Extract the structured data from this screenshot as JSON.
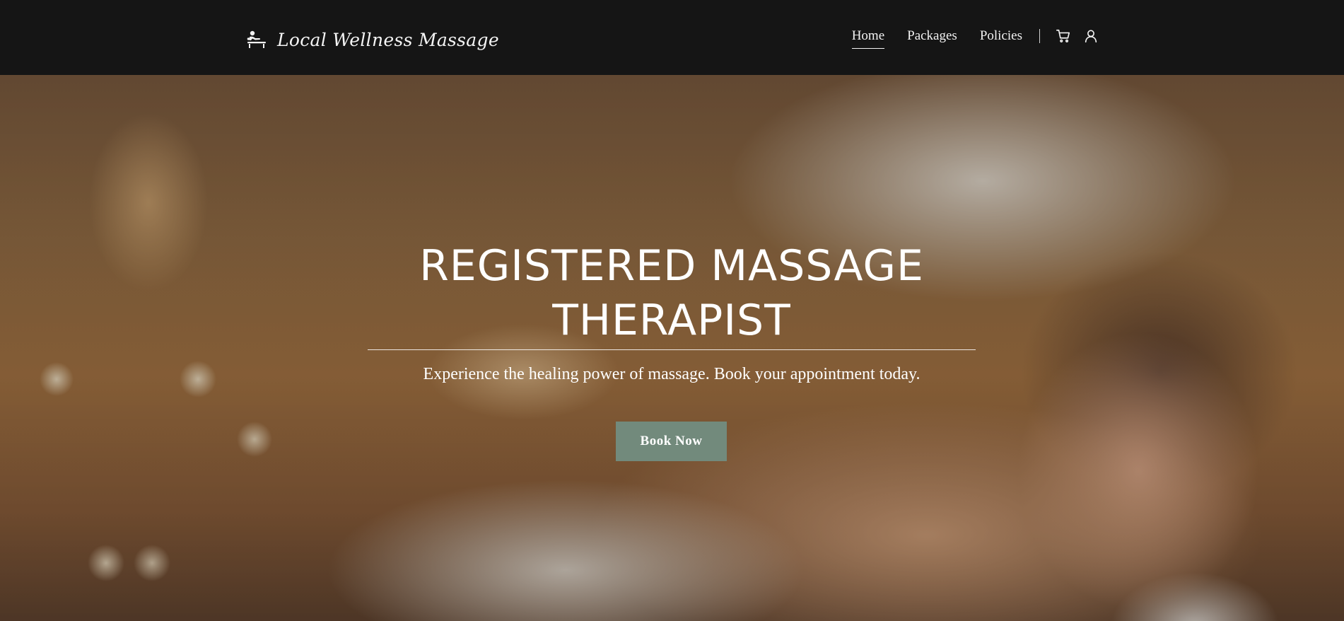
{
  "header": {
    "brand": {
      "name": "Local Wellness Massage",
      "icon": "massage-person-icon"
    },
    "nav": {
      "items": [
        {
          "label": "Home",
          "active": true
        },
        {
          "label": "Packages",
          "active": false
        },
        {
          "label": "Policies",
          "active": false
        }
      ],
      "icons": [
        "cart-icon",
        "user-icon"
      ]
    }
  },
  "hero": {
    "title": "REGISTERED MASSAGE THERAPIST",
    "subtitle": "Experience the healing power of massage. Book your appointment today.",
    "cta_label": "Book Now",
    "background_image": "massage-therapist-photo"
  },
  "colors": {
    "header_bg": "#151515",
    "nav_text": "#f2f2f2",
    "button_bg": "#728a7c",
    "button_text": "#ffffff",
    "hero_text": "#ffffff"
  }
}
